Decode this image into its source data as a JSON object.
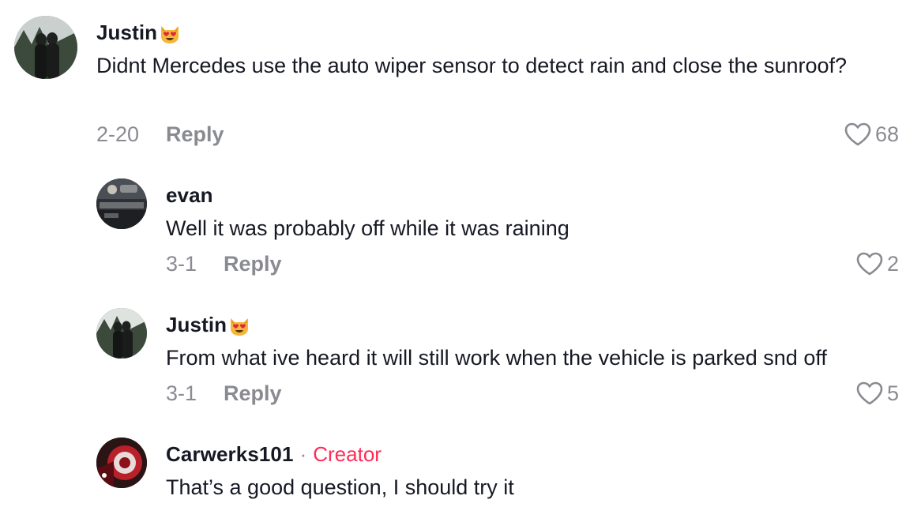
{
  "comments": [
    {
      "username": "Justin",
      "emoji": "smiling-cat-heart-eyes",
      "text": "Didnt Mercedes use the auto wiper sensor to detect rain and close the sunroof?",
      "date": "2-20",
      "reply_label": "Reply",
      "likes": "68"
    },
    {
      "username": "evan",
      "text": "Well it was probably off while it was raining",
      "date": "3-1",
      "reply_label": "Reply",
      "likes": "2"
    },
    {
      "username": "Justin",
      "emoji": "smiling-cat-heart-eyes",
      "text": "From what ive heard it will still work when the vehicle is parked snd off",
      "date": "3-1",
      "reply_label": "Reply",
      "likes": "5"
    },
    {
      "username": "Carwerks101",
      "separator": "·",
      "badge": "Creator",
      "text": "That’s a good question, I should try it"
    }
  ],
  "colors": {
    "text": "#161823",
    "muted": "#8a8b91",
    "creator": "#fe2c55"
  },
  "icons": {
    "like": "heart-outline-icon",
    "emoji": "smiling-cat-heart-eyes-emoji"
  }
}
